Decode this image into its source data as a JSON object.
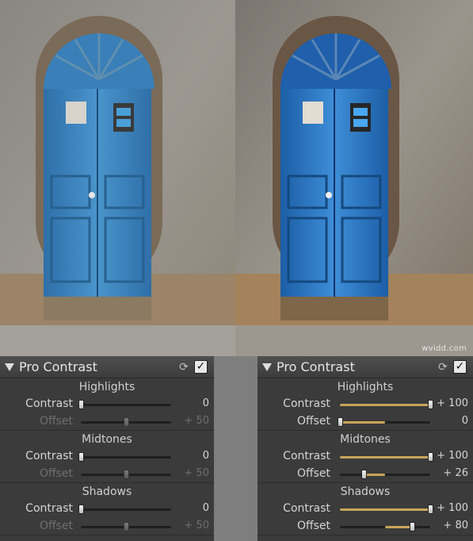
{
  "watermark": "wvidd.com",
  "colors": {
    "panel_bg": "#3b3b3b",
    "slider_fill": "#c8a55a",
    "door_before": "#3f8fc8",
    "door_after": "#2f7bd0"
  },
  "panels": [
    {
      "title": "Pro Contrast",
      "reset_icon": "reset-icon",
      "enabled_icon": "checkbox-checked-icon",
      "sections": [
        {
          "title": "Highlights",
          "contrast": {
            "label": "Contrast",
            "value": "0",
            "level": 0
          },
          "offset": {
            "label": "Offset",
            "value": "+ 50",
            "level": 0.5,
            "disabled": true
          }
        },
        {
          "title": "Midtones",
          "contrast": {
            "label": "Contrast",
            "value": "0",
            "level": 0
          },
          "offset": {
            "label": "Offset",
            "value": "+ 50",
            "level": 0.5,
            "disabled": true
          }
        },
        {
          "title": "Shadows",
          "contrast": {
            "label": "Contrast",
            "value": "0",
            "level": 0
          },
          "offset": {
            "label": "Offset",
            "value": "+ 50",
            "level": 0.5,
            "disabled": true
          }
        }
      ]
    },
    {
      "title": "Pro Contrast",
      "reset_icon": "reset-icon",
      "enabled_icon": "checkbox-checked-icon",
      "sections": [
        {
          "title": "Highlights",
          "contrast": {
            "label": "Contrast",
            "value": "+ 100",
            "level": 1
          },
          "offset": {
            "label": "Offset",
            "value": "0",
            "level": 0
          }
        },
        {
          "title": "Midtones",
          "contrast": {
            "label": "Contrast",
            "value": "+ 100",
            "level": 1
          },
          "offset": {
            "label": "Offset",
            "value": "+ 26",
            "level": 0.26
          }
        },
        {
          "title": "Shadows",
          "contrast": {
            "label": "Contrast",
            "value": "+ 100",
            "level": 1
          },
          "offset": {
            "label": "Offset",
            "value": "+ 80",
            "level": 0.8
          }
        }
      ]
    }
  ]
}
